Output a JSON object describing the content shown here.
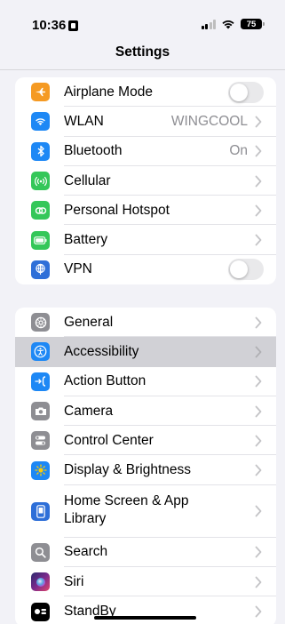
{
  "status_bar": {
    "time": "10:36",
    "battery": "75"
  },
  "nav": {
    "title": "Settings"
  },
  "groups": [
    {
      "rows": [
        {
          "label": "Airplane Mode",
          "icon": "airplane-icon",
          "color": "#f59a23",
          "accessory": "toggle",
          "toggle_on": false
        },
        {
          "label": "WLAN",
          "icon": "wifi-icon",
          "color": "#1e88f5",
          "value": "WINGCOOL",
          "accessory": "chevron"
        },
        {
          "label": "Bluetooth",
          "icon": "bluetooth-icon",
          "color": "#1e88f5",
          "value": "On",
          "accessory": "chevron"
        },
        {
          "label": "Cellular",
          "icon": "cellular-icon",
          "color": "#34c759",
          "accessory": "chevron"
        },
        {
          "label": "Personal Hotspot",
          "icon": "hotspot-icon",
          "color": "#34c759",
          "accessory": "chevron"
        },
        {
          "label": "Battery",
          "icon": "battery-icon",
          "color": "#34c759",
          "accessory": "chevron"
        },
        {
          "label": "VPN",
          "icon": "vpn-icon",
          "color": "#2e6fd8",
          "accessory": "toggle",
          "toggle_on": false
        }
      ]
    },
    {
      "rows": [
        {
          "label": "General",
          "icon": "gear-icon",
          "color": "#8e8e93",
          "accessory": "chevron"
        },
        {
          "label": "Accessibility",
          "icon": "accessibility-icon",
          "color": "#1e88f5",
          "accessory": "chevron",
          "selected": true
        },
        {
          "label": "Action Button",
          "icon": "action-button-icon",
          "color": "#1e88f5",
          "accessory": "chevron"
        },
        {
          "label": "Camera",
          "icon": "camera-icon",
          "color": "#8e8e93",
          "accessory": "chevron"
        },
        {
          "label": "Control Center",
          "icon": "control-center-icon",
          "color": "#8e8e93",
          "accessory": "chevron"
        },
        {
          "label": "Display & Brightness",
          "icon": "sun-icon",
          "color": "#1e88f5",
          "accessory": "chevron"
        },
        {
          "label": "Home Screen & App Library",
          "icon": "home-screen-icon",
          "color": "#2e6fd8",
          "accessory": "chevron"
        },
        {
          "label": "Search",
          "icon": "search-icon",
          "color": "#8e8e93",
          "accessory": "chevron"
        },
        {
          "label": "Siri",
          "icon": "siri-icon",
          "color": "#3a3a8c",
          "accessory": "chevron"
        },
        {
          "label": "StandBy",
          "icon": "standby-icon",
          "color": "#000000",
          "accessory": "chevron"
        }
      ]
    }
  ]
}
